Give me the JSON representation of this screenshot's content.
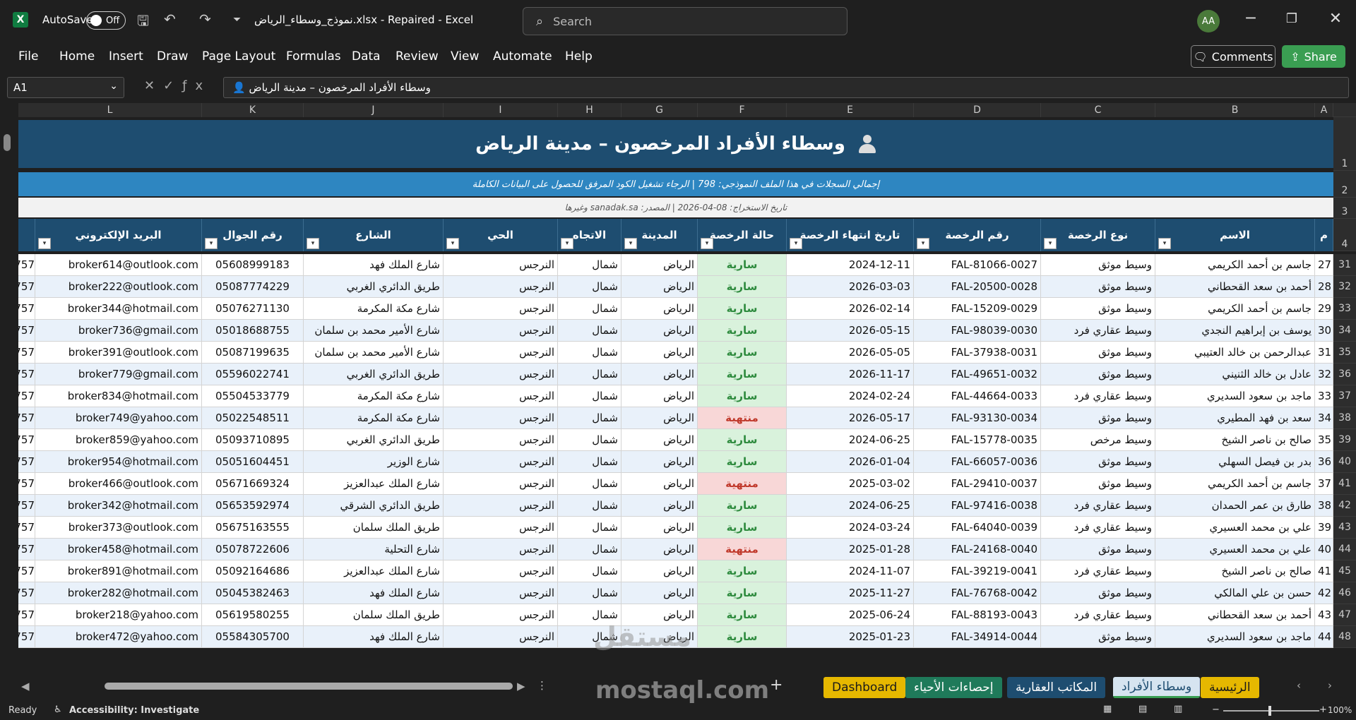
{
  "titlebar": {
    "autosave_label": "AutoSave",
    "toggle_label": "Off",
    "doc_title": "نموذج_وسطاء_الرياض.xlsx - Repaired - Excel",
    "search_placeholder": "Search",
    "avatar_initials": "AA"
  },
  "menu": {
    "items": [
      "File",
      "Home",
      "Insert",
      "Draw",
      "Page Layout",
      "Formulas",
      "Data",
      "Review",
      "View",
      "Automate",
      "Help"
    ],
    "comments_label": "Comments",
    "share_label": "Share"
  },
  "formulabar": {
    "cell_ref": "A1",
    "formula": "وسطاء الأفراد المرخصون – مدينة الرياض 👤"
  },
  "columns": [
    "L",
    "K",
    "J",
    "I",
    "H",
    "G",
    "F",
    "E",
    "D",
    "C",
    "B",
    "A"
  ],
  "sheet": {
    "title": "وسطاء الأفراد المرخصون – مدينة الرياض",
    "info": "إجمالي السجلات في هذا الملف النموذجي: 798  |  الرجاء تشغيل الكود المرفق للحصول على البيانات الكاملة",
    "source": "تاريخ الاستخراج: 08-04-2026  |  المصدر: sanadak.sa وغيرها",
    "headers": {
      "email": "البريد الإلكتروني",
      "phone": "رقم الجوال",
      "street": "الشارع",
      "district": "الحي",
      "direction": "الاتجاه",
      "city": "المدينة",
      "status": "حالة الرخصة",
      "expiry": "تاريخ انتهاء الرخصة",
      "license_no": "رقم الرخصة",
      "license_type": "نوع الرخصة",
      "name": "الاسم",
      "num": "م"
    },
    "header_rows": [
      "1",
      "2",
      "3",
      "4"
    ],
    "rows": [
      {
        "r": "31",
        "n": "27",
        "name": "جاسم بن أحمد الكريمي",
        "type": "وسيط موثق",
        "lic": "FAL-81066-0027",
        "exp": "2024-12-11",
        "status": "سارية",
        "city": "الرياض",
        "dir": "شمال",
        "dist": "النرجس",
        "street": "شارع الملك فهد",
        "phone": "05608999183",
        "email": "broker614@outlook.com",
        "k": "757"
      },
      {
        "r": "32",
        "n": "28",
        "name": "أحمد بن سعد القحطاني",
        "type": "وسيط موثق",
        "lic": "FAL-20500-0028",
        "exp": "2026-03-03",
        "status": "سارية",
        "city": "الرياض",
        "dir": "شمال",
        "dist": "النرجس",
        "street": "طريق الدائري الغربي",
        "phone": "05087774229",
        "email": "broker222@outlook.com",
        "k": "757"
      },
      {
        "r": "33",
        "n": "29",
        "name": "جاسم بن أحمد الكريمي",
        "type": "وسيط موثق",
        "lic": "FAL-15209-0029",
        "exp": "2026-02-14",
        "status": "سارية",
        "city": "الرياض",
        "dir": "شمال",
        "dist": "النرجس",
        "street": "شارع مكة المكرمة",
        "phone": "05076271130",
        "email": "broker344@hotmail.com",
        "k": "757"
      },
      {
        "r": "34",
        "n": "30",
        "name": "يوسف بن إبراهيم النجدي",
        "type": "وسيط عقاري فرد",
        "lic": "FAL-98039-0030",
        "exp": "2026-05-15",
        "status": "سارية",
        "city": "الرياض",
        "dir": "شمال",
        "dist": "النرجس",
        "street": "شارع الأمير محمد بن سلمان",
        "phone": "05018688755",
        "email": "broker736@gmail.com",
        "k": "757"
      },
      {
        "r": "35",
        "n": "31",
        "name": "عبدالرحمن بن خالد العتيبي",
        "type": "وسيط موثق",
        "lic": "FAL-37938-0031",
        "exp": "2026-05-05",
        "status": "سارية",
        "city": "الرياض",
        "dir": "شمال",
        "dist": "النرجس",
        "street": "شارع الأمير محمد بن سلمان",
        "phone": "05087199635",
        "email": "broker391@outlook.com",
        "k": "757"
      },
      {
        "r": "36",
        "n": "32",
        "name": "عادل بن خالد الثنيني",
        "type": "وسيط موثق",
        "lic": "FAL-49651-0032",
        "exp": "2026-11-17",
        "status": "سارية",
        "city": "الرياض",
        "dir": "شمال",
        "dist": "النرجس",
        "street": "طريق الدائري الغربي",
        "phone": "05596022741",
        "email": "broker779@gmail.com",
        "k": "757"
      },
      {
        "r": "37",
        "n": "33",
        "name": "ماجد بن سعود السديري",
        "type": "وسيط عقاري فرد",
        "lic": "FAL-44664-0033",
        "exp": "2024-02-24",
        "status": "سارية",
        "city": "الرياض",
        "dir": "شمال",
        "dist": "النرجس",
        "street": "شارع مكة المكرمة",
        "phone": "05504533779",
        "email": "broker834@hotmail.com",
        "k": "757"
      },
      {
        "r": "38",
        "n": "34",
        "name": "سعد بن فهد المطيري",
        "type": "وسيط موثق",
        "lic": "FAL-93130-0034",
        "exp": "2026-05-17",
        "status": "منتهية",
        "city": "الرياض",
        "dir": "شمال",
        "dist": "النرجس",
        "street": "شارع مكة المكرمة",
        "phone": "05022548511",
        "email": "broker749@yahoo.com",
        "k": "757"
      },
      {
        "r": "39",
        "n": "35",
        "name": "صالح بن ناصر الشيخ",
        "type": "وسيط مرخص",
        "lic": "FAL-15778-0035",
        "exp": "2024-06-25",
        "status": "سارية",
        "city": "الرياض",
        "dir": "شمال",
        "dist": "النرجس",
        "street": "طريق الدائري الغربي",
        "phone": "05093710895",
        "email": "broker859@yahoo.com",
        "k": "757"
      },
      {
        "r": "40",
        "n": "36",
        "name": "بدر بن فيصل السهلي",
        "type": "وسيط موثق",
        "lic": "FAL-66057-0036",
        "exp": "2026-01-04",
        "status": "سارية",
        "city": "الرياض",
        "dir": "شمال",
        "dist": "النرجس",
        "street": "شارع الوزير",
        "phone": "05051604451",
        "email": "broker954@hotmail.com",
        "k": "757"
      },
      {
        "r": "41",
        "n": "37",
        "name": "جاسم بن أحمد الكريمي",
        "type": "وسيط موثق",
        "lic": "FAL-29410-0037",
        "exp": "2025-03-02",
        "status": "منتهية",
        "city": "الرياض",
        "dir": "شمال",
        "dist": "النرجس",
        "street": "شارع الملك عبدالعزيز",
        "phone": "05671669324",
        "email": "broker466@outlook.com",
        "k": "757"
      },
      {
        "r": "42",
        "n": "38",
        "name": "طارق بن عمر الحمدان",
        "type": "وسيط عقاري فرد",
        "lic": "FAL-97416-0038",
        "exp": "2024-06-25",
        "status": "سارية",
        "city": "الرياض",
        "dir": "شمال",
        "dist": "النرجس",
        "street": "طريق الدائري الشرقي",
        "phone": "05653592974",
        "email": "broker342@hotmail.com",
        "k": "757"
      },
      {
        "r": "43",
        "n": "39",
        "name": "علي بن محمد العسيري",
        "type": "وسيط عقاري فرد",
        "lic": "FAL-64040-0039",
        "exp": "2024-03-24",
        "status": "سارية",
        "city": "الرياض",
        "dir": "شمال",
        "dist": "النرجس",
        "street": "طريق الملك سلمان",
        "phone": "05675163555",
        "email": "broker373@outlook.com",
        "k": "757"
      },
      {
        "r": "44",
        "n": "40",
        "name": "علي بن محمد العسيري",
        "type": "وسيط موثق",
        "lic": "FAL-24168-0040",
        "exp": "2025-01-28",
        "status": "منتهية",
        "city": "الرياض",
        "dir": "شمال",
        "dist": "النرجس",
        "street": "شارع التحلية",
        "phone": "05078722606",
        "email": "broker458@hotmail.com",
        "k": "757"
      },
      {
        "r": "45",
        "n": "41",
        "name": "صالح بن ناصر الشيخ",
        "type": "وسيط عقاري فرد",
        "lic": "FAL-39219-0041",
        "exp": "2024-11-07",
        "status": "سارية",
        "city": "الرياض",
        "dir": "شمال",
        "dist": "النرجس",
        "street": "شارع الملك عبدالعزيز",
        "phone": "05092164686",
        "email": "broker891@hotmail.com",
        "k": "757"
      },
      {
        "r": "46",
        "n": "42",
        "name": "حسن بن علي المالكي",
        "type": "وسيط موثق",
        "lic": "FAL-76768-0042",
        "exp": "2025-11-27",
        "status": "سارية",
        "city": "الرياض",
        "dir": "شمال",
        "dist": "النرجس",
        "street": "شارع الملك فهد",
        "phone": "05045382463",
        "email": "broker282@hotmail.com",
        "k": "757"
      },
      {
        "r": "47",
        "n": "43",
        "name": "أحمد بن سعد القحطاني",
        "type": "وسيط عقاري فرد",
        "lic": "FAL-88193-0043",
        "exp": "2025-06-24",
        "status": "سارية",
        "city": "الرياض",
        "dir": "شمال",
        "dist": "النرجس",
        "street": "طريق الملك سلمان",
        "phone": "05619580255",
        "email": "broker218@yahoo.com",
        "k": "757"
      },
      {
        "r": "48",
        "n": "44",
        "name": "ماجد بن سعود السديري",
        "type": "وسيط موثق",
        "lic": "FAL-34914-0044",
        "exp": "2025-01-23",
        "status": "سارية",
        "city": "الرياض",
        "dir": "شمال",
        "dist": "النرجس",
        "street": "شارع الملك فهد",
        "phone": "05584305700",
        "email": "broker472@yahoo.com",
        "k": "757"
      }
    ]
  },
  "tabs": {
    "items": [
      {
        "label": "الرئيسية",
        "bg": "#e6b800",
        "fg": "#1a1a1a"
      },
      {
        "label": "وسطاء الأفراد",
        "bg": "#d6e4f0",
        "fg": "#1e4d70",
        "active": true
      },
      {
        "label": "المكاتب العقارية",
        "bg": "#1e4d70",
        "fg": "#ffffff"
      },
      {
        "label": "إحصاءات الأحياء",
        "bg": "#1f7a5a",
        "fg": "#ffffff"
      },
      {
        "label": "Dashboard",
        "bg": "#e6b800",
        "fg": "#1a1a1a"
      }
    ],
    "add_label": "+"
  },
  "status": {
    "ready": "Ready",
    "accessibility": "Accessibility: Investigate",
    "zoom": "100%"
  },
  "watermark": {
    "ar": "مستقل",
    "en": "mostaql.com"
  }
}
